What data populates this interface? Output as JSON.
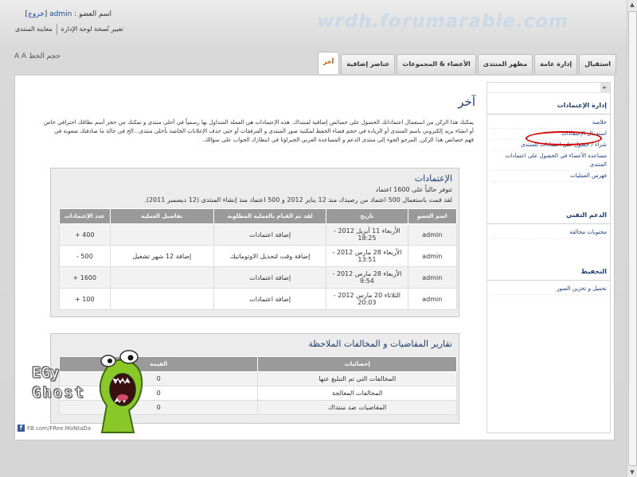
{
  "header": {
    "watermark": "wrdh.forumarabie.com",
    "user_line": {
      "label": "اسم العضو :",
      "username": "admin",
      "logout": "خروج"
    },
    "links": [
      "تغيير نُسخة لوحة الإدارة",
      "معاينة المنتدى"
    ],
    "font_size_label": "حجم الخط"
  },
  "tabs": [
    {
      "label": "استقبال"
    },
    {
      "label": "إدارة عامة"
    },
    {
      "label": "مظهر المنتدى"
    },
    {
      "label": "الأعضاء & المجموعات"
    },
    {
      "label": "عناصر إضافية"
    },
    {
      "label": "آخر",
      "active": true
    }
  ],
  "sidebar": {
    "sections": [
      {
        "title": "إدارة الإعتمادات",
        "items": [
          "خلاصة",
          "استعمال الإعتمادات",
          "شراء / حصول على اعتمادات للمنتدى",
          "مساعدة الأعضاء في الحصول على اعتمادات المنتدى",
          "فهرس العمليات"
        ]
      },
      {
        "title": "الدعم التقني",
        "items": [
          "محتويات مخالفة"
        ]
      },
      {
        "title": "التحفيظ",
        "items": [
          "تحميل و تخزين الصور"
        ]
      }
    ]
  },
  "main": {
    "title": "آخر",
    "description": "يمكنك هذا الركن من استعمال اعتماداتك الحصول على خصائص إضافية لمنتداك. هذه الإعتمادات هي العملة المتداول بها رسمياً في أحلى منتدى و تمكنك من حجز أسم نطاقك احترافي خاص أو انشاء بريد إلكتروني باسم المنتدى أو الزيادة في حجم فضاء الحفظ لمكتبة صور المنتدى و المرفقات أو حتى حذف الإعلانات الخاصة بأحلى منتدى...الخ في حالة ما صادفتك صعوبة في فهم خصائص هذا الركن, المرجو الجوء إلى منتدى الدعم و المساعدة العربي الخبراؤنا في انتظارك الجواب على سؤالك.",
    "credits": {
      "title": "الإعتمادات",
      "available_line": "تتوفر حالياً على 1600 اعتماد",
      "history_line": "لقد قمت باستعمال 500 اعتماد من رصيدك منذ 12 يناير 2012 و 500 اعتماد منذ إنشاء المنتدى (12 ديسمبر 2011).",
      "columns": [
        "اسم العضو",
        "تاريخ",
        "لقد تم القيام بالعملية المطلوبة",
        "تفاصيل العملية",
        "عدد الإعتمادات"
      ],
      "rows": [
        {
          "user": "admin",
          "date": "الأربعاء 11 أبريل 2012 - 18:25",
          "action": "إضافة اعتمادات",
          "details": "",
          "amount": "+ 400"
        },
        {
          "user": "admin",
          "date": "الأربعاء 28 مارس 2012 - 13:51",
          "action": "إضافة وقت لتحديل الاوتوماتيك",
          "details": "إضافة 12 شهر تشغيل",
          "amount": "- 500"
        },
        {
          "user": "admin",
          "date": "الأربعاء 28 مارس 2012 - 9:54",
          "action": "إضافة اعتمادات",
          "details": "",
          "amount": "+ 1600"
        },
        {
          "user": "admin",
          "date": "الثلاثاء 20 مارس 2012 - 20:03",
          "action": "إضافة اعتمادات",
          "details": "",
          "amount": "+ 100"
        }
      ]
    },
    "reports": {
      "title": "تقارير المقاضيات و المخالفات الملاحظة",
      "columns": [
        "إحصائيات",
        "القيمة"
      ],
      "rows": [
        {
          "label": "المخالفات التي تم التبليغ عنها",
          "value": "0"
        },
        {
          "label": "المخالفات المعالجة",
          "value": "0"
        },
        {
          "label": "المقاضيات ضد منتداك",
          "value": "0"
        }
      ]
    }
  },
  "overlay": {
    "logo_line1": "EGy",
    "logo_line2": "Ghost",
    "fb_text": "FB.com/FRee.MoNtaDa"
  },
  "colors": {
    "accent": "#b55400",
    "link": "#1a4aa0",
    "positive": "#148314",
    "negative": "#c00000",
    "highlight_circle": "#d20000"
  }
}
